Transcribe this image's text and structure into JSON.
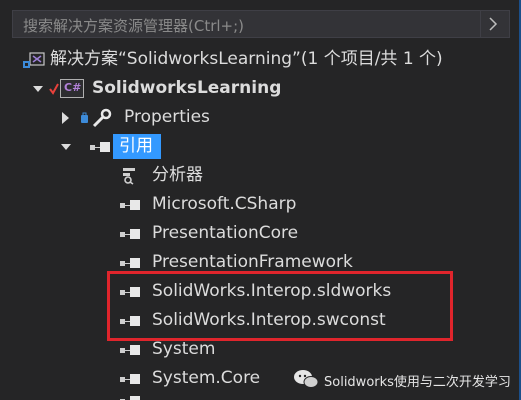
{
  "search": {
    "placeholder": "搜索解决方案资源管理器(Ctrl+;)"
  },
  "tree": {
    "solution_label": "解决方案“SolidworksLearning”(1 个项目/共 1 个)",
    "project_label": "SolidworksLearning",
    "project_badge": "C#",
    "properties_label": "Properties",
    "references_label": "引用",
    "references": [
      {
        "label": "分析器"
      },
      {
        "label": "Microsoft.CSharp"
      },
      {
        "label": "PresentationCore"
      },
      {
        "label": "PresentationFramework"
      },
      {
        "label": "SolidWorks.Interop.sldworks"
      },
      {
        "label": "SolidWorks.Interop.swconst"
      },
      {
        "label": "System"
      },
      {
        "label": "System.Core"
      }
    ]
  },
  "watermark": {
    "text": "Solidworks使用与二次开发学习"
  },
  "colors": {
    "background": "#252526",
    "selection": "#3399ff",
    "highlight_box": "#e0252c",
    "project_icon": "#9b4f96"
  },
  "icons": [
    "search-icon",
    "solution-icon",
    "csharp-project-icon",
    "wrench-icon",
    "reference-icon",
    "analyzer-icon",
    "wechat-icon"
  ]
}
